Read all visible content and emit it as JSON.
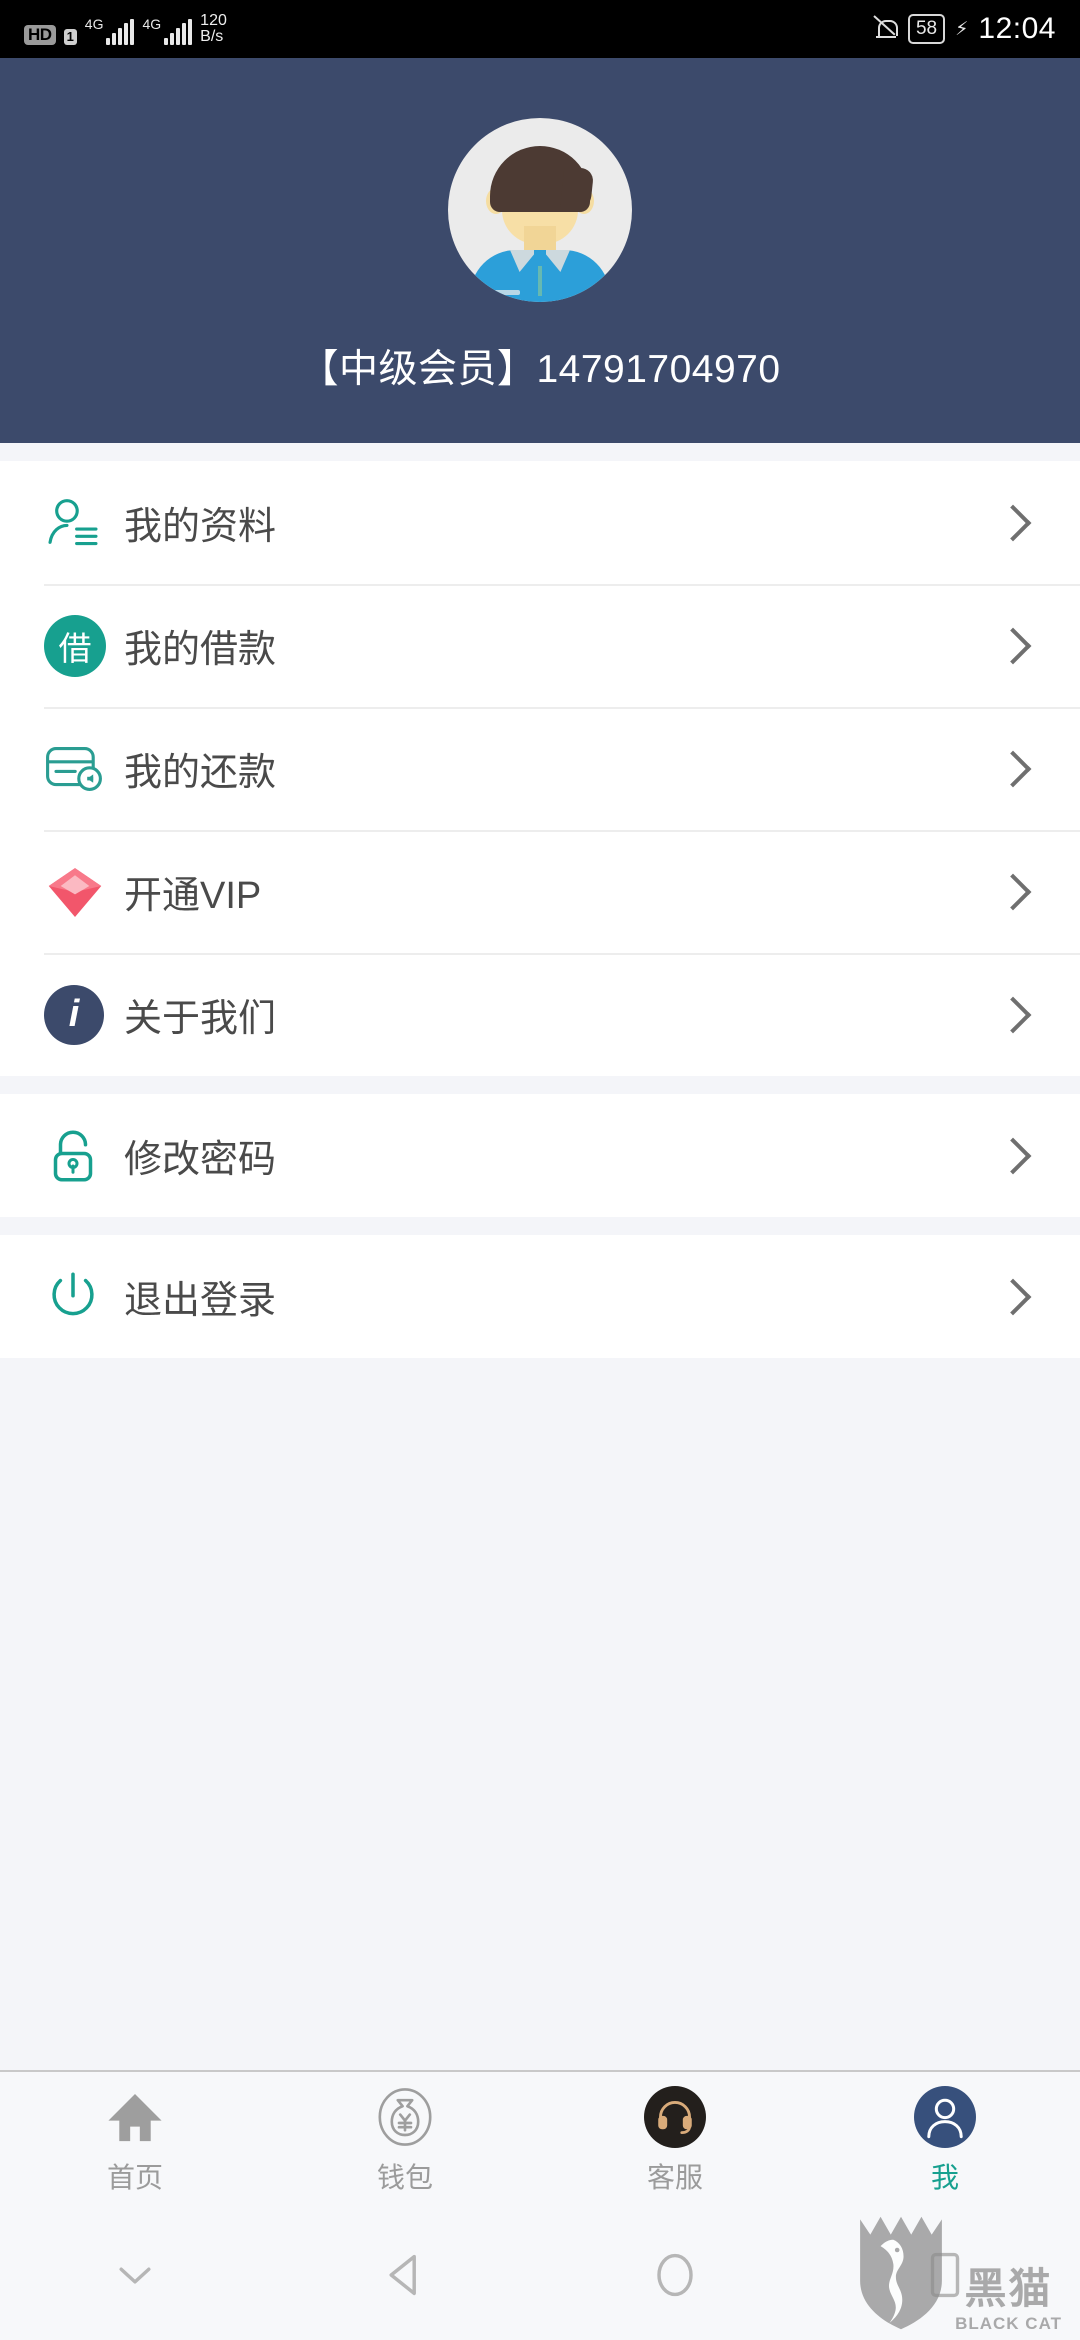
{
  "status_bar": {
    "hd_label": "HD",
    "sim_label": "1",
    "network_1": "4G",
    "network_2": "4G",
    "data_speed_value": "120",
    "data_speed_unit": "B/s",
    "mute_icon": "bell-muted-icon",
    "battery_level": "58",
    "charging_icon": "charging-bolt-icon",
    "time": "12:04"
  },
  "header": {
    "avatar_icon": "user-avatar-illustration",
    "username": "【中级会员】14791704970",
    "background_color": "#3c4a6b"
  },
  "menu": {
    "group_1": [
      {
        "icon": "profile-person-icon",
        "label": "我的资料",
        "chevron": "chevron-right-icon"
      },
      {
        "icon": "loan-badge-icon",
        "icon_text": "借",
        "label": "我的借款",
        "chevron": "chevron-right-icon"
      },
      {
        "icon": "repayment-card-icon",
        "label": "我的还款",
        "chevron": "chevron-right-icon"
      },
      {
        "icon": "vip-diamond-icon",
        "label": "开通VIP",
        "chevron": "chevron-right-icon"
      },
      {
        "icon": "info-circle-icon",
        "label": "关于我们",
        "chevron": "chevron-right-icon"
      }
    ],
    "group_2": [
      {
        "icon": "lock-icon",
        "label": "修改密码",
        "chevron": "chevron-right-icon"
      }
    ],
    "group_3": [
      {
        "icon": "power-icon",
        "label": "退出登录",
        "chevron": "chevron-right-icon"
      }
    ]
  },
  "tabbar": {
    "items": [
      {
        "icon": "home-icon",
        "label": "首页",
        "active": false
      },
      {
        "icon": "wallet-money-bag-icon",
        "label": "钱包",
        "active": false
      },
      {
        "icon": "customer-service-headset-icon",
        "label": "客服",
        "active": false
      },
      {
        "icon": "me-person-icon",
        "label": "我",
        "active": true
      }
    ],
    "active_color": "#17a08f",
    "inactive_color": "#9b9b9b"
  },
  "system_nav": {
    "hide_icon": "chevron-down-icon",
    "back_icon": "back-triangle-icon",
    "home_icon": "home-circle-icon",
    "recents_icon": "recents-square-icon"
  },
  "watermark": {
    "cn": "黑猫",
    "en": "BLACK CAT",
    "logo_icon": "black-cat-shield-icon"
  },
  "colors": {
    "header_navy": "#3c4a6b",
    "accent_teal": "#17a08f",
    "vip_red": "#f2566b",
    "page_bg": "#f4f5f9"
  }
}
